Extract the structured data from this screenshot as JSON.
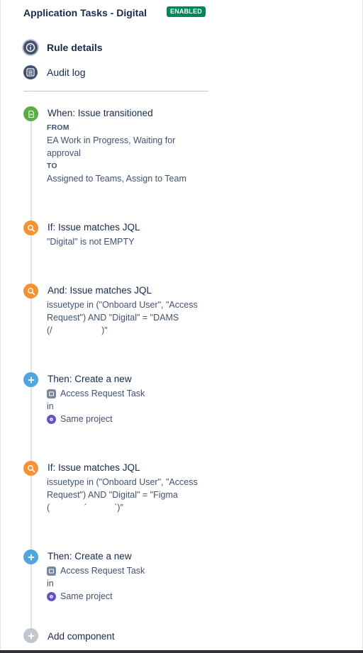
{
  "header": {
    "title": "Application Tasks - Digital",
    "status_badge": "ENABLED"
  },
  "nav": {
    "rule_details": "Rule details",
    "audit_log": "Audit log"
  },
  "steps": {
    "trigger": {
      "title": "When: Issue transitioned",
      "from_label": "FROM",
      "from_line1": "EA Work in Progress, Waiting for",
      "from_line2": "approval",
      "to_label": "TO",
      "to_value": "Assigned to Teams, Assign to Team"
    },
    "cond1": {
      "title": "If: Issue matches JQL",
      "line1": "\"Digital\" is not EMPTY"
    },
    "cond2": {
      "title": "And: Issue matches JQL",
      "line1": "issuetype in (\"Onboard User\", \"Access",
      "line2": "Request\") AND \"Digital\" = \"DAMS",
      "line3": "(/                    )\""
    },
    "action1": {
      "title": "Then: Create a new",
      "issue_type": "Access Request Task",
      "in_label": "in",
      "project": "Same project"
    },
    "cond3": {
      "title": "If: Issue matches JQL",
      "line1": "issuetype in (\"Onboard User\", \"Access",
      "line2": "Request\") AND \"Digital\" = \"Figma",
      "line3": "(              ´           `)\""
    },
    "action2": {
      "title": "Then: Create a new",
      "issue_type": "Access Request Task",
      "in_label": "in",
      "project": "Same project"
    },
    "add": {
      "title": "Add component"
    }
  },
  "icons": {
    "rule_details": "info-icon",
    "audit_log": "list-icon",
    "trigger": "transition-icon",
    "condition": "search-icon",
    "action": "plus-icon",
    "add": "plus-icon"
  },
  "colors": {
    "badge": "#00875a",
    "trigger": "#5aac44",
    "condition": "#f79232",
    "action": "#4ea5e0",
    "add": "#c1c7d0"
  }
}
